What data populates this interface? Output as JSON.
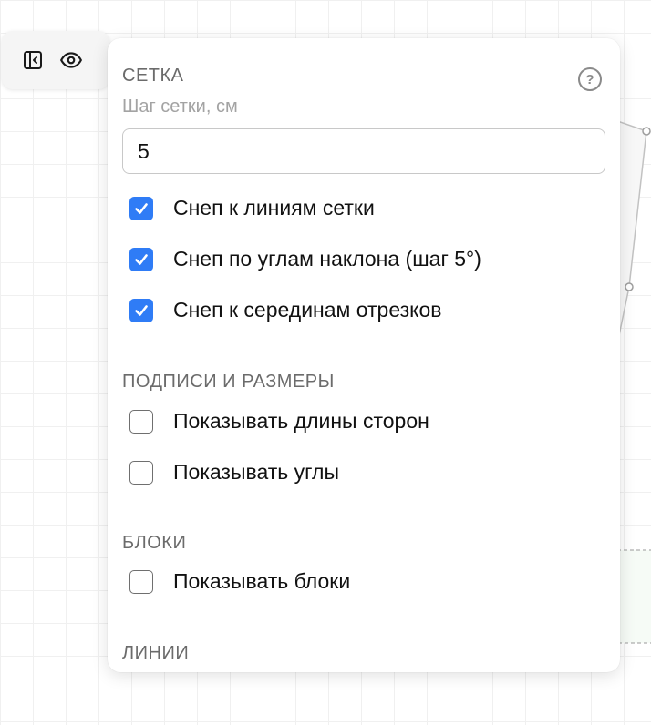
{
  "toolbar": {
    "items": [
      {
        "name": "sidebar-toggle",
        "icon": "sidebar-collapse-icon"
      },
      {
        "name": "visibility",
        "icon": "eye-icon"
      }
    ]
  },
  "panel": {
    "help_icon": "question-circle-icon",
    "help_label": "?",
    "grid": {
      "title": "СЕТКА",
      "step_label": "Шаг сетки, см",
      "step_value": "5",
      "options": [
        {
          "label": "Снеп к линиям сетки",
          "checked": true
        },
        {
          "label": "Снеп по углам наклона (шаг 5°)",
          "checked": true
        },
        {
          "label": "Снеп к серединам отрезков",
          "checked": true
        }
      ]
    },
    "labels": {
      "title": "ПОДПИСИ И РАЗМЕРЫ",
      "options": [
        {
          "label": "Показывать длины сторон",
          "checked": false
        },
        {
          "label": "Показывать углы",
          "checked": false
        }
      ]
    },
    "blocks": {
      "title": "БЛОКИ",
      "options": [
        {
          "label": "Показывать блоки",
          "checked": false
        }
      ]
    },
    "lines": {
      "title": "ЛИНИИ"
    }
  },
  "colors": {
    "accent": "#2f7cf6",
    "canvas_grid": "#f0f0f0",
    "shape_stroke": "#bdbdbd"
  }
}
